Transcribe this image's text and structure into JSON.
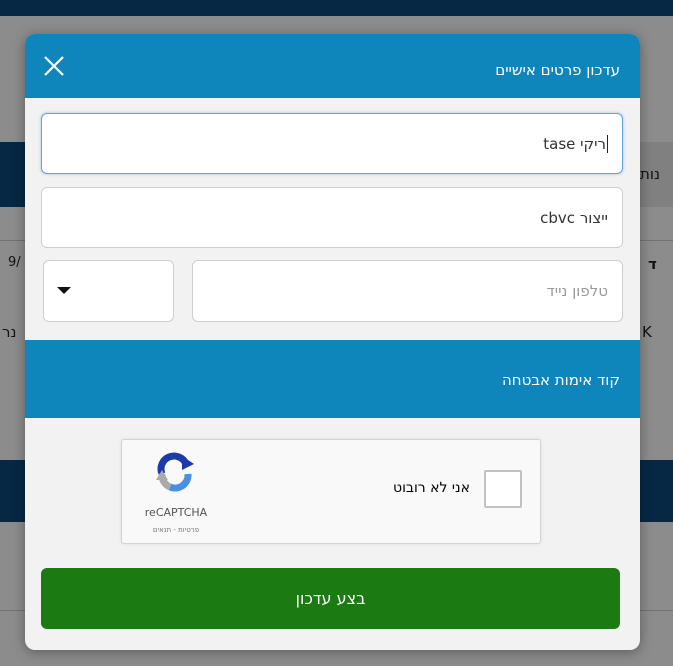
{
  "background": {
    "snippets": [
      "נות",
      "9/",
      "ד",
      "K",
      "נר"
    ]
  },
  "modal": {
    "title": "עדכון פרטים אישיים",
    "fields": {
      "name_value": "ריקי tase",
      "company_value": "ייצור cbvc",
      "phone_placeholder": "טלפון נייד"
    },
    "security_section_label": "קוד אימות אבטחה",
    "captcha": {
      "checkbox_label": "אני לא רובוט",
      "brand": "reCAPTCHA",
      "links": "פרטיות - תנאים"
    },
    "submit_label": "בצע עדכון"
  },
  "colors": {
    "header": "#0e86bb",
    "submit": "#1c7a12",
    "focus_border": "#62a4e0"
  },
  "icons": {
    "close": "close-icon",
    "dropdown": "chevron-down-icon",
    "captcha": "recaptcha-logo-icon"
  }
}
